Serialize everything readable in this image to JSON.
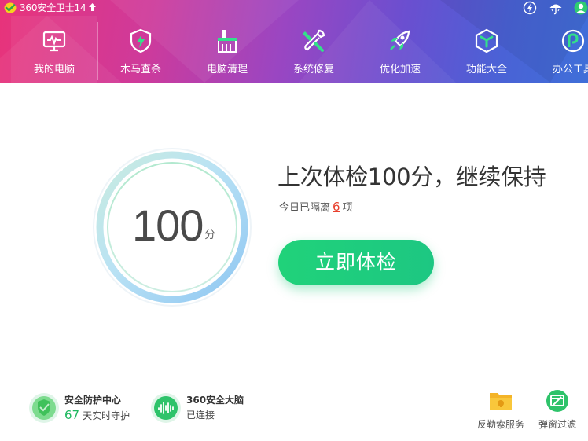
{
  "titlebar": {
    "app_title": "360安全卫士14",
    "icons": [
      "update-arrow-icon",
      "lightning-icon",
      "umbrella-icon",
      "user-avatar-icon"
    ]
  },
  "nav": {
    "items": [
      {
        "label": "我的电脑",
        "icon": "monitor-icon",
        "active": true
      },
      {
        "label": "木马查杀",
        "icon": "shield-bolt-icon"
      },
      {
        "label": "电脑清理",
        "icon": "broom-icon"
      },
      {
        "label": "系统修复",
        "icon": "wrench-icon"
      },
      {
        "label": "优化加速",
        "icon": "rocket-icon"
      },
      {
        "label": "功能大全",
        "icon": "cube-icon"
      },
      {
        "label": "办公工具",
        "icon": "office-icon"
      }
    ]
  },
  "main": {
    "score": "100",
    "score_unit": "分",
    "headline": "上次体检100分，继续保持",
    "subline_prefix": "今日已隔离",
    "subline_count": "6",
    "subline_suffix": "项",
    "check_button": "立即体检"
  },
  "footer": {
    "protection": {
      "title": "安全防护中心",
      "days": "67",
      "days_suffix": "天实时守护"
    },
    "brain": {
      "title": "360安全大脑",
      "status": "已连接"
    },
    "tools": [
      {
        "label": "反勒索服务",
        "icon": "folder-lock-icon"
      },
      {
        "label": "弹窗过滤",
        "icon": "popup-block-icon"
      }
    ]
  },
  "colors": {
    "accent_green": "#1fcf7c",
    "alert_red": "#e8412e",
    "header_pink": "#e8337a",
    "header_blue": "#3f6fd8"
  }
}
